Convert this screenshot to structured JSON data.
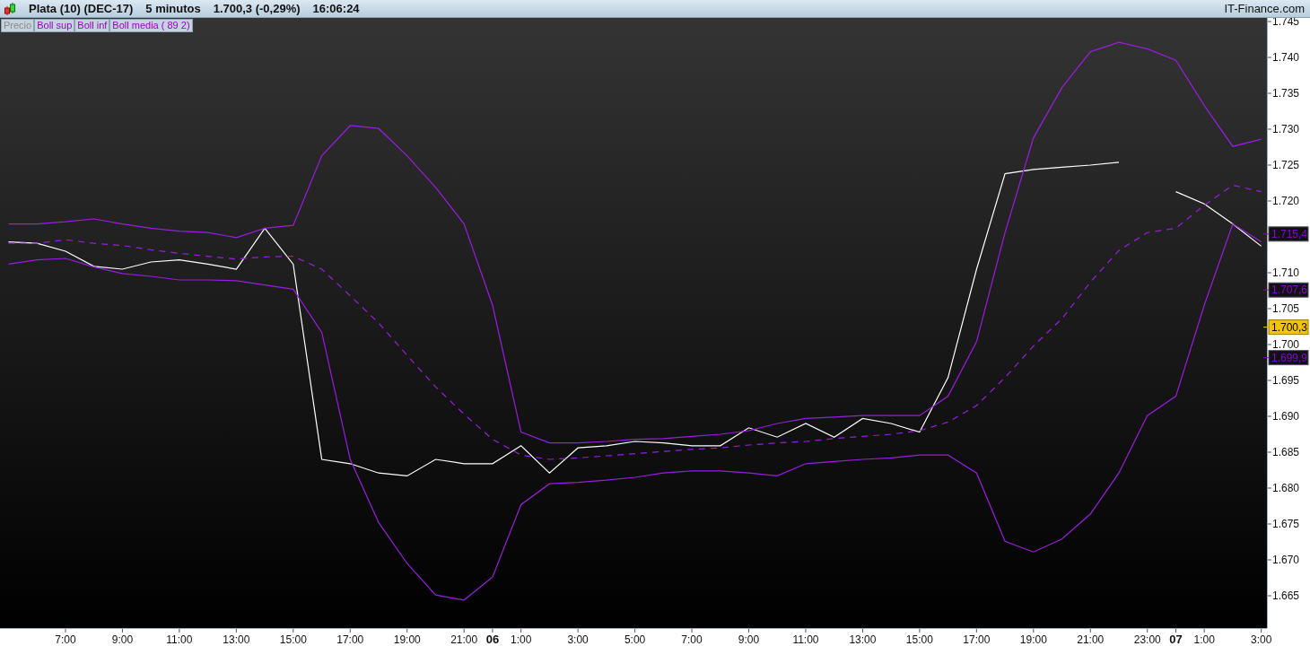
{
  "header": {
    "title": "Plata (10) (DEC-17)",
    "timeframe": "5 minutos",
    "quote": "1.700,3 (-0,29%)",
    "time": "16:06:24",
    "brand": "IT-Finance.com"
  },
  "chart": {
    "chart_data": {
      "type": "line",
      "ylim": [
        1660.5,
        1745.5
      ],
      "yticks": [
        {
          "value": 1665,
          "label": "1.665"
        },
        {
          "value": 1670,
          "label": "1.670"
        },
        {
          "value": 1675,
          "label": "1.675"
        },
        {
          "value": 1680,
          "label": "1.680"
        },
        {
          "value": 1685,
          "label": "1.685"
        },
        {
          "value": 1690,
          "label": "1.690"
        },
        {
          "value": 1695,
          "label": "1.695"
        },
        {
          "value": 1700,
          "label": "1.700"
        },
        {
          "value": 1705,
          "label": "1.705"
        },
        {
          "value": 1710,
          "label": "1.710"
        },
        {
          "value": 1720,
          "label": "1.720"
        },
        {
          "value": 1725,
          "label": "1.725"
        },
        {
          "value": 1730,
          "label": "1.730"
        },
        {
          "value": 1735,
          "label": "1.735"
        },
        {
          "value": 1740,
          "label": "1.740"
        },
        {
          "value": 1745,
          "label": "1.745"
        }
      ],
      "categories": [
        null,
        null,
        "7:00",
        null,
        "9:00",
        null,
        "11:00",
        null,
        "13:00",
        null,
        "15:00",
        null,
        "17:00",
        null,
        "19:00",
        null,
        "21:00",
        "06",
        "1:00",
        null,
        "3:00",
        null,
        "5:00",
        null,
        "7:00",
        null,
        "9:00",
        null,
        "11:00",
        null,
        "13:00",
        null,
        "15:00",
        null,
        "17:00",
        null,
        "19:00",
        null,
        "21:00",
        null,
        "23:00",
        "07",
        "1:00",
        null,
        "3:00"
      ],
      "series": [
        {
          "name": "Precio",
          "color": "#ffffff",
          "line_style": "solid",
          "values": [
            1714.3,
            1714.1,
            1713,
            1710.9,
            1710.5,
            1711.5,
            1711.8,
            1711.2,
            1710.5,
            1716.2,
            1711.2,
            1684,
            1683.4,
            1682.1,
            1681.7,
            1684,
            1683.4,
            1683.4,
            1685.9,
            1682.1,
            1685.6,
            1685.9,
            1686.5,
            1686.3,
            1685.9,
            1685.9,
            1688.4,
            1687.1,
            1689,
            1687.1,
            1689.7,
            1689,
            1687.8,
            1695.4,
            1710.5,
            1723.8,
            1724.4,
            1724.7,
            1725,
            1725.4,
            null,
            1721.3,
            1719.6,
            1716.8,
            1713.7
          ]
        },
        {
          "name": "Boll sup",
          "color": "#9a1de0",
          "line_style": "solid",
          "values": [
            1716.8,
            1716.8,
            1717.1,
            1717.5,
            1716.8,
            1716.2,
            1715.8,
            1715.6,
            1714.9,
            1716.2,
            1716.6,
            1726.3,
            1730.5,
            1730.1,
            1726.3,
            1721.9,
            1716.8,
            1705.5,
            1687.8,
            1686.3,
            1686.3,
            1686.5,
            1686.8,
            1686.9,
            1687.2,
            1687.5,
            1688,
            1689,
            1689.7,
            1689.9,
            1690.1,
            1690.1,
            1690.1,
            1692.8,
            1700.4,
            1715.6,
            1728.8,
            1735.8,
            1740.8,
            1742.1,
            1741.2,
            1739.6,
            1733.3,
            1727.6,
            1728.6
          ]
        },
        {
          "name": "Boll inf",
          "color": "#9a1de0",
          "line_style": "solid",
          "values": [
            1711.2,
            1711.8,
            1712,
            1710.8,
            1709.9,
            1709.5,
            1709,
            1709,
            1708.9,
            1708.3,
            1707.7,
            1701.7,
            1684,
            1675.2,
            1669.5,
            1665.1,
            1664.4,
            1667.6,
            1677.7,
            1680.6,
            1680.8,
            1681.1,
            1681.5,
            1682.1,
            1682.4,
            1682.4,
            1682.1,
            1681.7,
            1683.4,
            1683.7,
            1684,
            1684.2,
            1684.6,
            1684.6,
            1682.1,
            1672.6,
            1671.1,
            1672.9,
            1676.4,
            1682.1,
            1690.1,
            1692.8,
            1705.5,
            1716.8,
            1714.3
          ]
        },
        {
          "name": "Boll media ( 89 2)",
          "color": "#9a1de0",
          "line_style": "dashed",
          "values": [
            1714.1,
            1714.1,
            1714.6,
            1714.1,
            1713.8,
            1713.2,
            1712.7,
            1712.3,
            1711.9,
            1712.2,
            1712.3,
            1710.5,
            1706.8,
            1703,
            1698.5,
            1694.1,
            1690.3,
            1686.8,
            1684.6,
            1684,
            1684.2,
            1684.5,
            1684.8,
            1685.1,
            1685.4,
            1685.6,
            1686,
            1686.3,
            1686.5,
            1686.9,
            1687.2,
            1687.5,
            1688,
            1689.2,
            1691.5,
            1695.4,
            1699.8,
            1703.6,
            1708.7,
            1713.1,
            1715.6,
            1716.2,
            1719.4,
            1722.2,
            1721.3
          ]
        }
      ]
    },
    "legend": [
      {
        "color": "#8c8c8c"
      },
      {
        "color": "#9a00cc"
      },
      {
        "color": "#9a00cc"
      },
      {
        "color": "#9a00cc"
      }
    ],
    "axis_labels": [
      {
        "kind": "time"
      },
      {
        "kind": "time"
      },
      {
        "kind": "time"
      },
      {
        "kind": "time"
      },
      {
        "kind": "time"
      },
      {
        "kind": "time"
      },
      {
        "kind": "time"
      },
      {
        "kind": "time"
      },
      {
        "kind": "day"
      },
      {
        "kind": "time"
      },
      {
        "kind": "time"
      },
      {
        "kind": "time"
      },
      {
        "kind": "time"
      },
      {
        "kind": "time"
      },
      {
        "kind": "time"
      },
      {
        "kind": "time"
      },
      {
        "kind": "time"
      },
      {
        "kind": "time"
      },
      {
        "kind": "time"
      },
      {
        "kind": "time"
      },
      {
        "kind": "time"
      },
      {
        "kind": "day"
      },
      {
        "kind": "time"
      },
      {
        "kind": "time"
      }
    ],
    "price_markers": [
      {
        "value": "1.715,4",
        "kind": "indicator"
      },
      {
        "value": "1.707,6",
        "kind": "indicator"
      },
      {
        "value": "1.700,3",
        "kind": "price"
      },
      {
        "value": "1.699,9",
        "kind": "indicator"
      }
    ]
  }
}
